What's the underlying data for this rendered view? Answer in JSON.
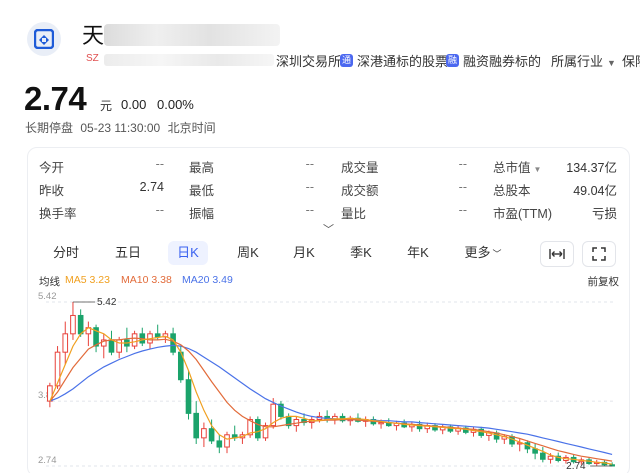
{
  "header": {
    "title": "天",
    "market": "SZ",
    "exchange": "深圳交易所",
    "tags": [
      {
        "icon": "通",
        "label": "深港通标的股票"
      },
      {
        "icon": "融",
        "label": "融资融券标的"
      }
    ],
    "industry": "所属行业",
    "extra": "保险"
  },
  "quote": {
    "price": "2.74",
    "unit": "元",
    "change": "0.00",
    "change_pct": "0.00%",
    "status": "长期停盘",
    "time": "05-23 11:30:00",
    "timezone": "北京时间"
  },
  "stats": [
    [
      {
        "label": "今开",
        "value": "--"
      },
      {
        "label": "最高",
        "value": "--"
      },
      {
        "label": "成交量",
        "value": "--"
      },
      {
        "label": "总市值",
        "value": "134.37亿"
      }
    ],
    [
      {
        "label": "昨收",
        "value": "2.74"
      },
      {
        "label": "最低",
        "value": "--"
      },
      {
        "label": "成交额",
        "value": "--"
      },
      {
        "label": "总股本",
        "value": "49.04亿"
      }
    ],
    [
      {
        "label": "换手率",
        "value": "--"
      },
      {
        "label": "振幅",
        "value": "--"
      },
      {
        "label": "量比",
        "value": "--"
      },
      {
        "label": "市盈(TTM)",
        "value": "亏损"
      }
    ]
  ],
  "tabs": [
    "分时",
    "五日",
    "日K",
    "周K",
    "月K",
    "季K",
    "年K",
    "更多"
  ],
  "active_tab": "日K",
  "indicators": {
    "label": "均线",
    "ma5": "MA5 3.23",
    "ma10": "MA10 3.38",
    "ma20": "MA20 3.49",
    "adjust": "前复权"
  },
  "colors": {
    "up": "#e8413a",
    "down": "#1ba36b",
    "ma5": "#f0a020",
    "ma10": "#e26b3a",
    "ma20": "#4a72e8",
    "accent": "#3a62f0"
  },
  "chart_data": {
    "type": "candlestick",
    "y_axis_labels": [
      "5.42",
      "3.8",
      "2.74"
    ],
    "annotations": {
      "high": "5.42",
      "low": "2.74"
    },
    "ohlc": [
      [
        3.8,
        4.1,
        3.7,
        4.05
      ],
      [
        4.05,
        4.7,
        4.0,
        4.6
      ],
      [
        4.6,
        5.1,
        4.4,
        4.9
      ],
      [
        4.9,
        5.42,
        4.8,
        5.2
      ],
      [
        5.2,
        5.3,
        4.85,
        4.9
      ],
      [
        4.9,
        5.1,
        4.7,
        5.0
      ],
      [
        5.0,
        5.05,
        4.6,
        4.7
      ],
      [
        4.7,
        4.9,
        4.5,
        4.8
      ],
      [
        4.8,
        4.95,
        4.55,
        4.6
      ],
      [
        4.6,
        4.85,
        4.5,
        4.8
      ],
      [
        4.8,
        5.0,
        4.6,
        4.7
      ],
      [
        4.7,
        4.95,
        4.65,
        4.9
      ],
      [
        4.9,
        5.0,
        4.7,
        4.75
      ],
      [
        4.75,
        4.95,
        4.65,
        4.9
      ],
      [
        4.9,
        5.05,
        4.8,
        4.85
      ],
      [
        4.85,
        4.95,
        4.75,
        4.9
      ],
      [
        4.9,
        5.0,
        4.55,
        4.6
      ],
      [
        4.6,
        4.7,
        4.1,
        4.15
      ],
      [
        4.15,
        4.3,
        3.5,
        3.6
      ],
      [
        3.6,
        3.8,
        3.1,
        3.2
      ],
      [
        3.2,
        3.45,
        3.05,
        3.35
      ],
      [
        3.35,
        3.5,
        3.1,
        3.15
      ],
      [
        3.15,
        3.25,
        2.95,
        3.05
      ],
      [
        3.05,
        3.3,
        2.95,
        3.25
      ],
      [
        3.25,
        3.4,
        3.15,
        3.2
      ],
      [
        3.2,
        3.3,
        3.1,
        3.25
      ],
      [
        3.25,
        3.55,
        3.2,
        3.5
      ],
      [
        3.5,
        3.55,
        3.15,
        3.2
      ],
      [
        3.2,
        3.45,
        3.15,
        3.4
      ],
      [
        3.4,
        3.85,
        3.35,
        3.75
      ],
      [
        3.75,
        3.8,
        3.5,
        3.55
      ],
      [
        3.55,
        3.6,
        3.35,
        3.4
      ],
      [
        3.4,
        3.55,
        3.3,
        3.5
      ],
      [
        3.5,
        3.6,
        3.4,
        3.45
      ],
      [
        3.45,
        3.55,
        3.35,
        3.5
      ],
      [
        3.5,
        3.62,
        3.45,
        3.55
      ],
      [
        3.55,
        3.65,
        3.45,
        3.5
      ],
      [
        3.5,
        3.6,
        3.42,
        3.55
      ],
      [
        3.55,
        3.6,
        3.45,
        3.48
      ],
      [
        3.48,
        3.56,
        3.4,
        3.52
      ],
      [
        3.52,
        3.6,
        3.45,
        3.47
      ],
      [
        3.47,
        3.55,
        3.38,
        3.5
      ],
      [
        3.5,
        3.55,
        3.4,
        3.43
      ],
      [
        3.43,
        3.5,
        3.35,
        3.45
      ],
      [
        3.45,
        3.52,
        3.38,
        3.4
      ],
      [
        3.4,
        3.48,
        3.32,
        3.44
      ],
      [
        3.44,
        3.5,
        3.36,
        3.38
      ],
      [
        3.38,
        3.46,
        3.3,
        3.42
      ],
      [
        3.42,
        3.48,
        3.3,
        3.35
      ],
      [
        3.35,
        3.45,
        3.28,
        3.4
      ],
      [
        3.4,
        3.44,
        3.3,
        3.33
      ],
      [
        3.33,
        3.42,
        3.26,
        3.38
      ],
      [
        3.38,
        3.42,
        3.28,
        3.31
      ],
      [
        3.31,
        3.4,
        3.25,
        3.36
      ],
      [
        3.36,
        3.4,
        3.26,
        3.29
      ],
      [
        3.29,
        3.38,
        3.22,
        3.34
      ],
      [
        3.34,
        3.38,
        3.2,
        3.24
      ],
      [
        3.24,
        3.32,
        3.15,
        3.28
      ],
      [
        3.28,
        3.32,
        3.12,
        3.18
      ],
      [
        3.18,
        3.26,
        3.1,
        3.22
      ],
      [
        3.22,
        3.26,
        3.05,
        3.1
      ],
      [
        3.1,
        3.18,
        2.98,
        3.12
      ],
      [
        3.12,
        3.16,
        2.95,
        3.02
      ],
      [
        3.02,
        3.1,
        2.85,
        2.95
      ],
      [
        2.95,
        3.05,
        2.8,
        2.85
      ],
      [
        2.85,
        2.95,
        2.78,
        2.9
      ],
      [
        2.9,
        2.96,
        2.8,
        2.83
      ],
      [
        2.83,
        2.92,
        2.78,
        2.88
      ],
      [
        2.88,
        2.92,
        2.78,
        2.81
      ],
      [
        2.81,
        2.88,
        2.76,
        2.84
      ],
      [
        2.84,
        2.88,
        2.76,
        2.78
      ],
      [
        2.78,
        2.84,
        2.74,
        2.8
      ],
      [
        2.8,
        2.83,
        2.74,
        2.76
      ],
      [
        2.76,
        2.8,
        2.74,
        2.74
      ]
    ],
    "ma5": [
      3.8,
      4.1,
      4.4,
      4.7,
      4.9,
      5.0,
      4.95,
      4.9,
      4.8,
      4.75,
      4.75,
      4.77,
      4.8,
      4.82,
      4.84,
      4.86,
      4.8,
      4.6,
      4.3,
      3.95,
      3.65,
      3.4,
      3.25,
      3.18,
      3.2,
      3.22,
      3.28,
      3.3,
      3.35,
      3.45,
      3.52,
      3.55,
      3.55,
      3.52,
      3.48,
      3.48,
      3.5,
      3.51,
      3.51,
      3.52,
      3.51,
      3.5,
      3.48,
      3.47,
      3.45,
      3.44,
      3.42,
      3.41,
      3.4,
      3.39,
      3.38,
      3.37,
      3.36,
      3.35,
      3.34,
      3.32,
      3.3,
      3.28,
      3.25,
      3.22,
      3.18,
      3.13,
      3.08,
      3.03,
      2.98,
      2.92,
      2.88,
      2.86,
      2.85,
      2.83,
      2.82,
      2.8,
      2.79,
      2.77
    ],
    "ma10": [
      3.8,
      3.95,
      4.15,
      4.35,
      4.5,
      4.65,
      4.72,
      4.78,
      4.8,
      4.8,
      4.82,
      4.83,
      4.82,
      4.8,
      4.8,
      4.81,
      4.78,
      4.72,
      4.62,
      4.48,
      4.3,
      4.12,
      3.95,
      3.78,
      3.65,
      3.55,
      3.48,
      3.42,
      3.38,
      3.38,
      3.4,
      3.42,
      3.44,
      3.46,
      3.47,
      3.48,
      3.49,
      3.49,
      3.5,
      3.5,
      3.49,
      3.48,
      3.47,
      3.46,
      3.45,
      3.44,
      3.43,
      3.42,
      3.41,
      3.4,
      3.39,
      3.38,
      3.37,
      3.36,
      3.35,
      3.34,
      3.32,
      3.3,
      3.28,
      3.25,
      3.22,
      3.19,
      3.15,
      3.11,
      3.07,
      3.03,
      2.99,
      2.96,
      2.93,
      2.9,
      2.88,
      2.86,
      2.84,
      2.82
    ],
    "ma20": [
      3.8,
      3.85,
      3.92,
      4.0,
      4.1,
      4.2,
      4.28,
      4.36,
      4.42,
      4.48,
      4.53,
      4.58,
      4.62,
      4.65,
      4.68,
      4.7,
      4.71,
      4.7,
      4.66,
      4.6,
      4.52,
      4.44,
      4.36,
      4.27,
      4.18,
      4.09,
      4.0,
      3.92,
      3.84,
      3.78,
      3.72,
      3.67,
      3.62,
      3.58,
      3.55,
      3.53,
      3.52,
      3.51,
      3.5,
      3.5,
      3.5,
      3.49,
      3.49,
      3.48,
      3.48,
      3.47,
      3.46,
      3.46,
      3.45,
      3.44,
      3.43,
      3.42,
      3.41,
      3.4,
      3.39,
      3.38,
      3.37,
      3.36,
      3.34,
      3.32,
      3.3,
      3.28,
      3.26,
      3.23,
      3.2,
      3.17,
      3.14,
      3.11,
      3.08,
      3.05,
      3.02,
      2.99,
      2.96,
      2.93
    ]
  }
}
